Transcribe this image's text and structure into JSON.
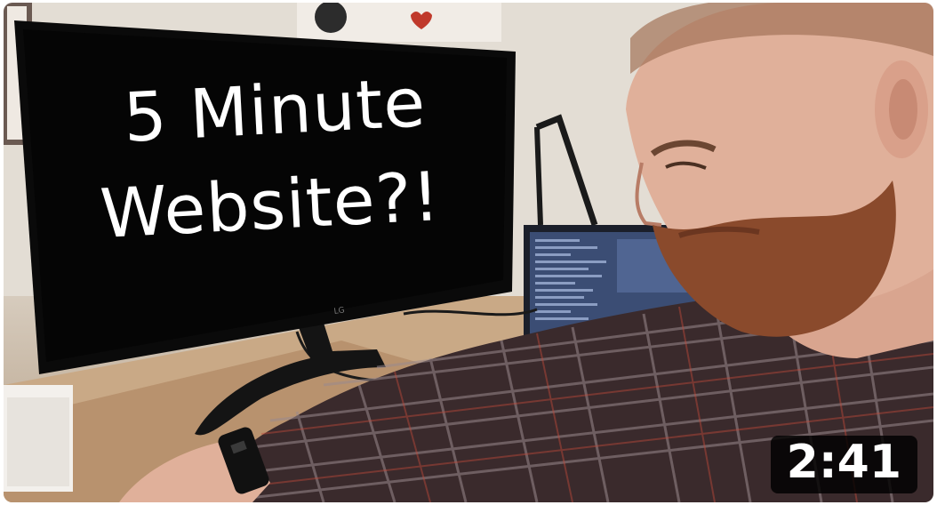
{
  "thumbnail": {
    "overlay_text_line1": "5 Minute",
    "overlay_text_line2": "Website?!",
    "duration": "2:41"
  },
  "colors": {
    "monitor_screen": "#050505",
    "shirt_dark": "#3a2a2c",
    "shirt_check": "#9a8a8e",
    "beard": "#8a4a2c",
    "skin": "#e0b09a",
    "desk": "#c9a986",
    "wall": "#e3ddd4"
  }
}
